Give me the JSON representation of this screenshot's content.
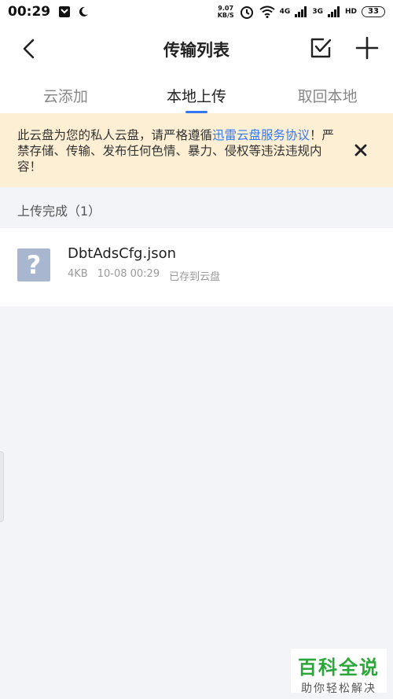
{
  "status_bar": {
    "time": "00:29",
    "net_speed_value": "9.07",
    "net_speed_unit": "KB/S",
    "signal_1_label": "4G",
    "signal_2_label": "3G",
    "hd_label": "HD",
    "battery": "33"
  },
  "header": {
    "title": "传输列表"
  },
  "tabs": [
    {
      "label": "云添加"
    },
    {
      "label": "本地上传"
    },
    {
      "label": "取回本地"
    }
  ],
  "notice": {
    "text_before": "此云盘为您的私人云盘，请严格遵循",
    "link_text": "迅雷云盘服务协议",
    "text_after": "！严禁存储、传输、发布任何色情、暴力、侵权等违法违规内容！"
  },
  "section": {
    "title": "上传完成（1）"
  },
  "files": [
    {
      "name": "DbtAdsCfg.json",
      "size": "4KB",
      "date": "10-08 00:29",
      "status": "已存到云盘",
      "icon_glyph": "?"
    }
  ],
  "watermark": {
    "title": "百科全说",
    "subtitle": "助你轻松解决"
  }
}
